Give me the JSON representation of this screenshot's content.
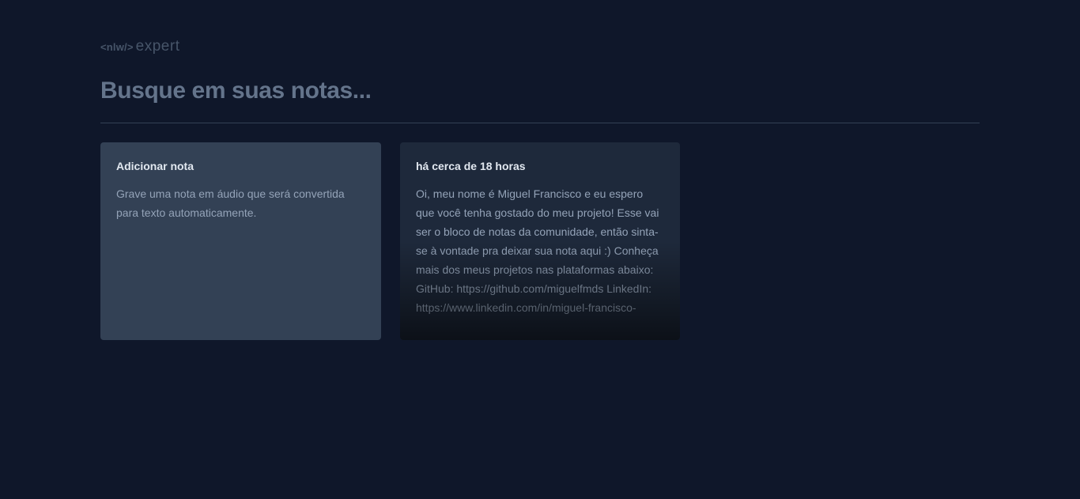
{
  "header": {
    "logo_tag": "<nlw/>",
    "logo_word": "expert"
  },
  "search": {
    "placeholder": "Busque em suas notas..."
  },
  "cards": {
    "add": {
      "title": "Adicionar nota",
      "text": "Grave uma nota em áudio que será convertida para texto automaticamente."
    },
    "note": {
      "date": "há cerca de 18 horas",
      "text": "Oi, meu nome é Miguel Francisco e eu espero que você tenha gostado do meu projeto! Esse vai ser o bloco de notas da comunidade, então sinta-se à vontade pra deixar sua nota aqui :) Conheça mais dos meus projetos nas plataformas abaixo: GitHub: https://github.com/miguelfmds LinkedIn: https://www.linkedin.com/in/miguel-francisco-"
    }
  },
  "colors": {
    "background": "#0f172a",
    "add_card": "#334155",
    "note_card": "#1e293b",
    "placeholder": "#64748b",
    "divider": "#334155"
  }
}
